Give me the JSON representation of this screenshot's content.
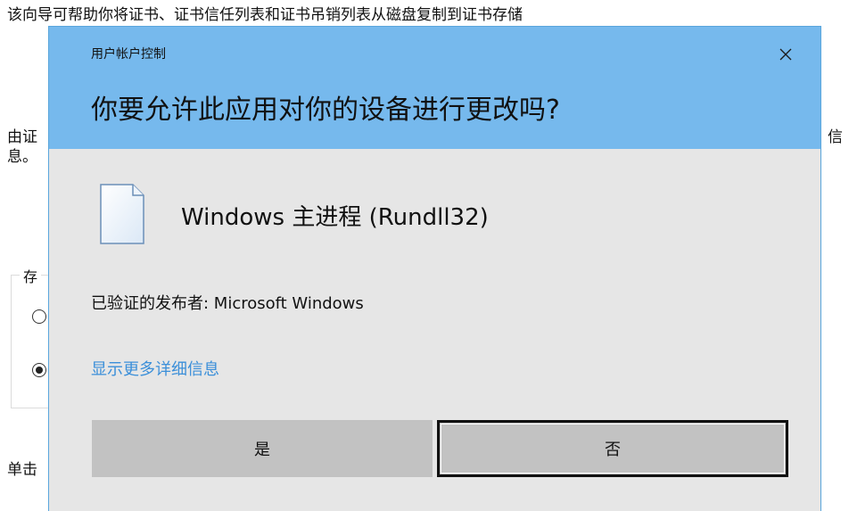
{
  "background_page": {
    "description_line": "该向导可帮助你将证书、证书信任列表和证书吊销列表从磁盘复制到证书存储",
    "store_text_left": "由证",
    "store_text_right": "信",
    "store_text_end": "息。",
    "group_label": "存",
    "click_text": "单击"
  },
  "uac_dialog": {
    "title": "用户帐户控制",
    "question": "你要允许此应用对你的设备进行更改吗?",
    "app_name": "Windows 主进程 (Rundll32)",
    "publisher": "已验证的发布者: Microsoft Windows",
    "details_link": "显示更多详细信息",
    "yes_label": "是",
    "no_label": "否",
    "colors": {
      "header": "#76b9ed",
      "body": "#e6e6e6",
      "button": "#c2c2c2",
      "link": "#3b8fd9"
    },
    "icons": {
      "close": "close-icon",
      "app": "document-icon"
    }
  }
}
